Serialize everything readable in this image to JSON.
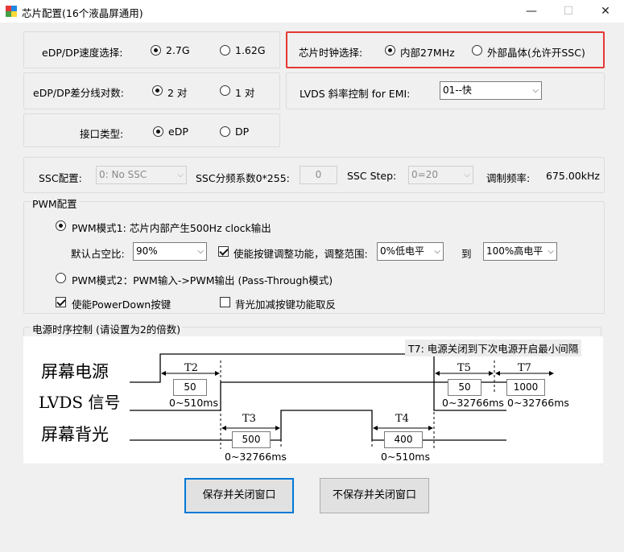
{
  "window": {
    "title": "芯片配置(16个液晶屏通用)",
    "controls": {
      "minimize": "—",
      "maximize": "☐",
      "close": "✕"
    }
  },
  "edp_speed": {
    "label": "eDP/DP速度选择:",
    "options": [
      "2.7G",
      "1.62G"
    ],
    "selected": 0
  },
  "chip_clock": {
    "label": "芯片时钟选择:",
    "options": [
      "内部27MHz",
      "外部晶体(允许开SSC)"
    ],
    "selected": 0,
    "highlight_color": "#e53935"
  },
  "lanes": {
    "label": "eDP/DP差分线对数:",
    "options": [
      "2 对",
      "1 对"
    ],
    "selected": 0
  },
  "lvds_slew": {
    "label": "LVDS 斜率控制 for EMI:",
    "value": "01--快"
  },
  "interface": {
    "label": "接口类型:",
    "options": [
      "eDP",
      "DP"
    ],
    "selected": 0
  },
  "ssc": {
    "config_label": "SSC配置:",
    "config_value": "0: No SSC",
    "div_label": "SSC分频系数0*255:",
    "div_value": "0",
    "step_label": "SSC Step:",
    "step_value": "0=20",
    "freq_label": "调制频率:",
    "freq_value": "675.00kHz"
  },
  "pwm": {
    "group_title": "PWM配置",
    "mode1_label": "PWM模式1: 芯片内部产生500Hz clock输出",
    "mode1_selected": true,
    "duty_label": "默认占空比:",
    "duty_value": "90%",
    "keyadj_label": "使能按键调整功能，调整范围:",
    "keyadj_checked": true,
    "range_low": "0%低电平",
    "range_to": "到",
    "range_high": "100%高电平",
    "mode2_label": "PWM模式2：PWM输入->PWM输出 (Pass-Through模式)",
    "mode2_selected": false,
    "powerdown_label": "使能PowerDown按键",
    "powerdown_checked": true,
    "invert_label": "背光加减按键功能取反",
    "invert_checked": false
  },
  "sequence": {
    "group_title": "电源时序控制 (请设置为2的倍数)",
    "note": "T7: 电源关闭到下次电源开启最小间隔",
    "signals": [
      "屏幕电源",
      "LVDS 信号",
      "屏幕背光"
    ],
    "timings": [
      {
        "name": "T2",
        "value": "50",
        "range": "0~510ms"
      },
      {
        "name": "T3",
        "value": "500",
        "range": "0~32766ms"
      },
      {
        "name": "T4",
        "value": "400",
        "range": "0~510ms"
      },
      {
        "name": "T5",
        "value": "50",
        "range": "0~32766ms"
      },
      {
        "name": "T7",
        "value": "1000",
        "range": "0~32766ms"
      }
    ]
  },
  "buttons": {
    "save": "保存并关闭窗口",
    "nosave": "不保存并关闭窗口"
  }
}
